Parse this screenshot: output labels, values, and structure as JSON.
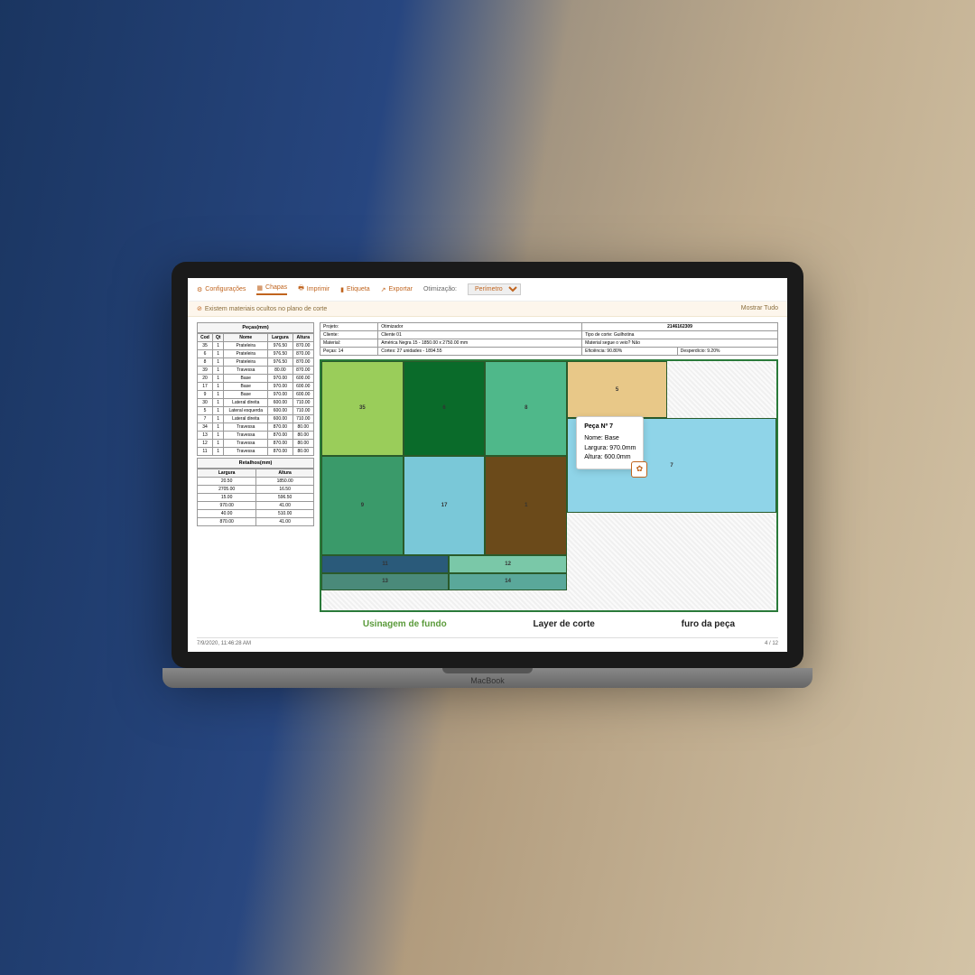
{
  "toolbar": {
    "config": "Configurações",
    "chapas": "Chapas",
    "imprimir": "Imprimir",
    "etiqueta": "Etiqueta",
    "exportar": "Exportar",
    "otim_label": "Otimização:",
    "otim_value": "Perímetro"
  },
  "warning": {
    "text": "Existem materiais ocultos no plano de corte",
    "action": "Mostrar Tudo"
  },
  "info": {
    "projeto_l": "Projeto:",
    "projeto_v": "Otimizador",
    "cliente_l": "Cliente:",
    "cliente_v": "Cliente 01",
    "material_l": "Material:",
    "material_v": "América Negra 15 - 1850.00 x 2750.00 mm",
    "pecas_l": "Peças: 14",
    "cortes_l": "Cortes: 27 unidades - 1894.55",
    "efic_l": "Eficiência: 90.80%",
    "id": "2146162309",
    "tipo_l": "Tipo de corte: Guilhotina",
    "veio_l": "Material segue o veio? Não",
    "desp_l": "Desperdício: 9.20%"
  },
  "pecas_title": "Peças(mm)",
  "pecas_head": [
    "Cod",
    "Qt",
    "Nome",
    "Largura",
    "Altura"
  ],
  "pecas_rows": [
    [
      "35",
      "1",
      "Prateleira",
      "976.50",
      "870.00"
    ],
    [
      "6",
      "1",
      "Prateleira",
      "976.50",
      "870.00"
    ],
    [
      "8",
      "1",
      "Prateleira",
      "976.50",
      "870.00"
    ],
    [
      "39",
      "1",
      "Travessa",
      "80.00",
      "870.00"
    ],
    [
      "20",
      "1",
      "Base",
      "970.00",
      "600.00"
    ],
    [
      "17",
      "1",
      "Base",
      "970.00",
      "600.00"
    ],
    [
      "9",
      "1",
      "Base",
      "970.00",
      "600.00"
    ],
    [
      "30",
      "1",
      "Lateral direita",
      "600.00",
      "710.00"
    ],
    [
      "5",
      "1",
      "Lateral esquerda",
      "600.00",
      "710.00"
    ],
    [
      "7",
      "1",
      "Lateral direita",
      "600.00",
      "710.00"
    ],
    [
      "34",
      "1",
      "Travessa",
      "870.00",
      "80.00"
    ],
    [
      "13",
      "1",
      "Travessa",
      "870.00",
      "80.00"
    ],
    [
      "12",
      "1",
      "Travessa",
      "870.00",
      "80.00"
    ],
    [
      "11",
      "1",
      "Travessa",
      "870.00",
      "80.00"
    ]
  ],
  "retalhos_title": "Retalhos(mm)",
  "retalhos_head": [
    "Largura",
    "Altura"
  ],
  "retalhos_rows": [
    [
      "20.50",
      "1850.00"
    ],
    [
      "2705.00",
      "16.50"
    ],
    [
      "15.00",
      "596.50"
    ],
    [
      "970.00",
      "41.00"
    ],
    [
      "40.00",
      "510.00"
    ],
    [
      "870.00",
      "41.00"
    ]
  ],
  "tooltip": {
    "title": "Peça Nº 7",
    "l1": "Nome: Base",
    "l2": "Largura: 970.0mm",
    "l3": "Altura: 600.0mm"
  },
  "annotations": {
    "a1": "Usinagem de fundo",
    "a2": "Layer de corte",
    "a3": "furo da peça"
  },
  "footer": {
    "ts": "7/9/2020, 11:46:28 AM",
    "page": "4 / 12"
  },
  "laptop_brand": "MacBook"
}
